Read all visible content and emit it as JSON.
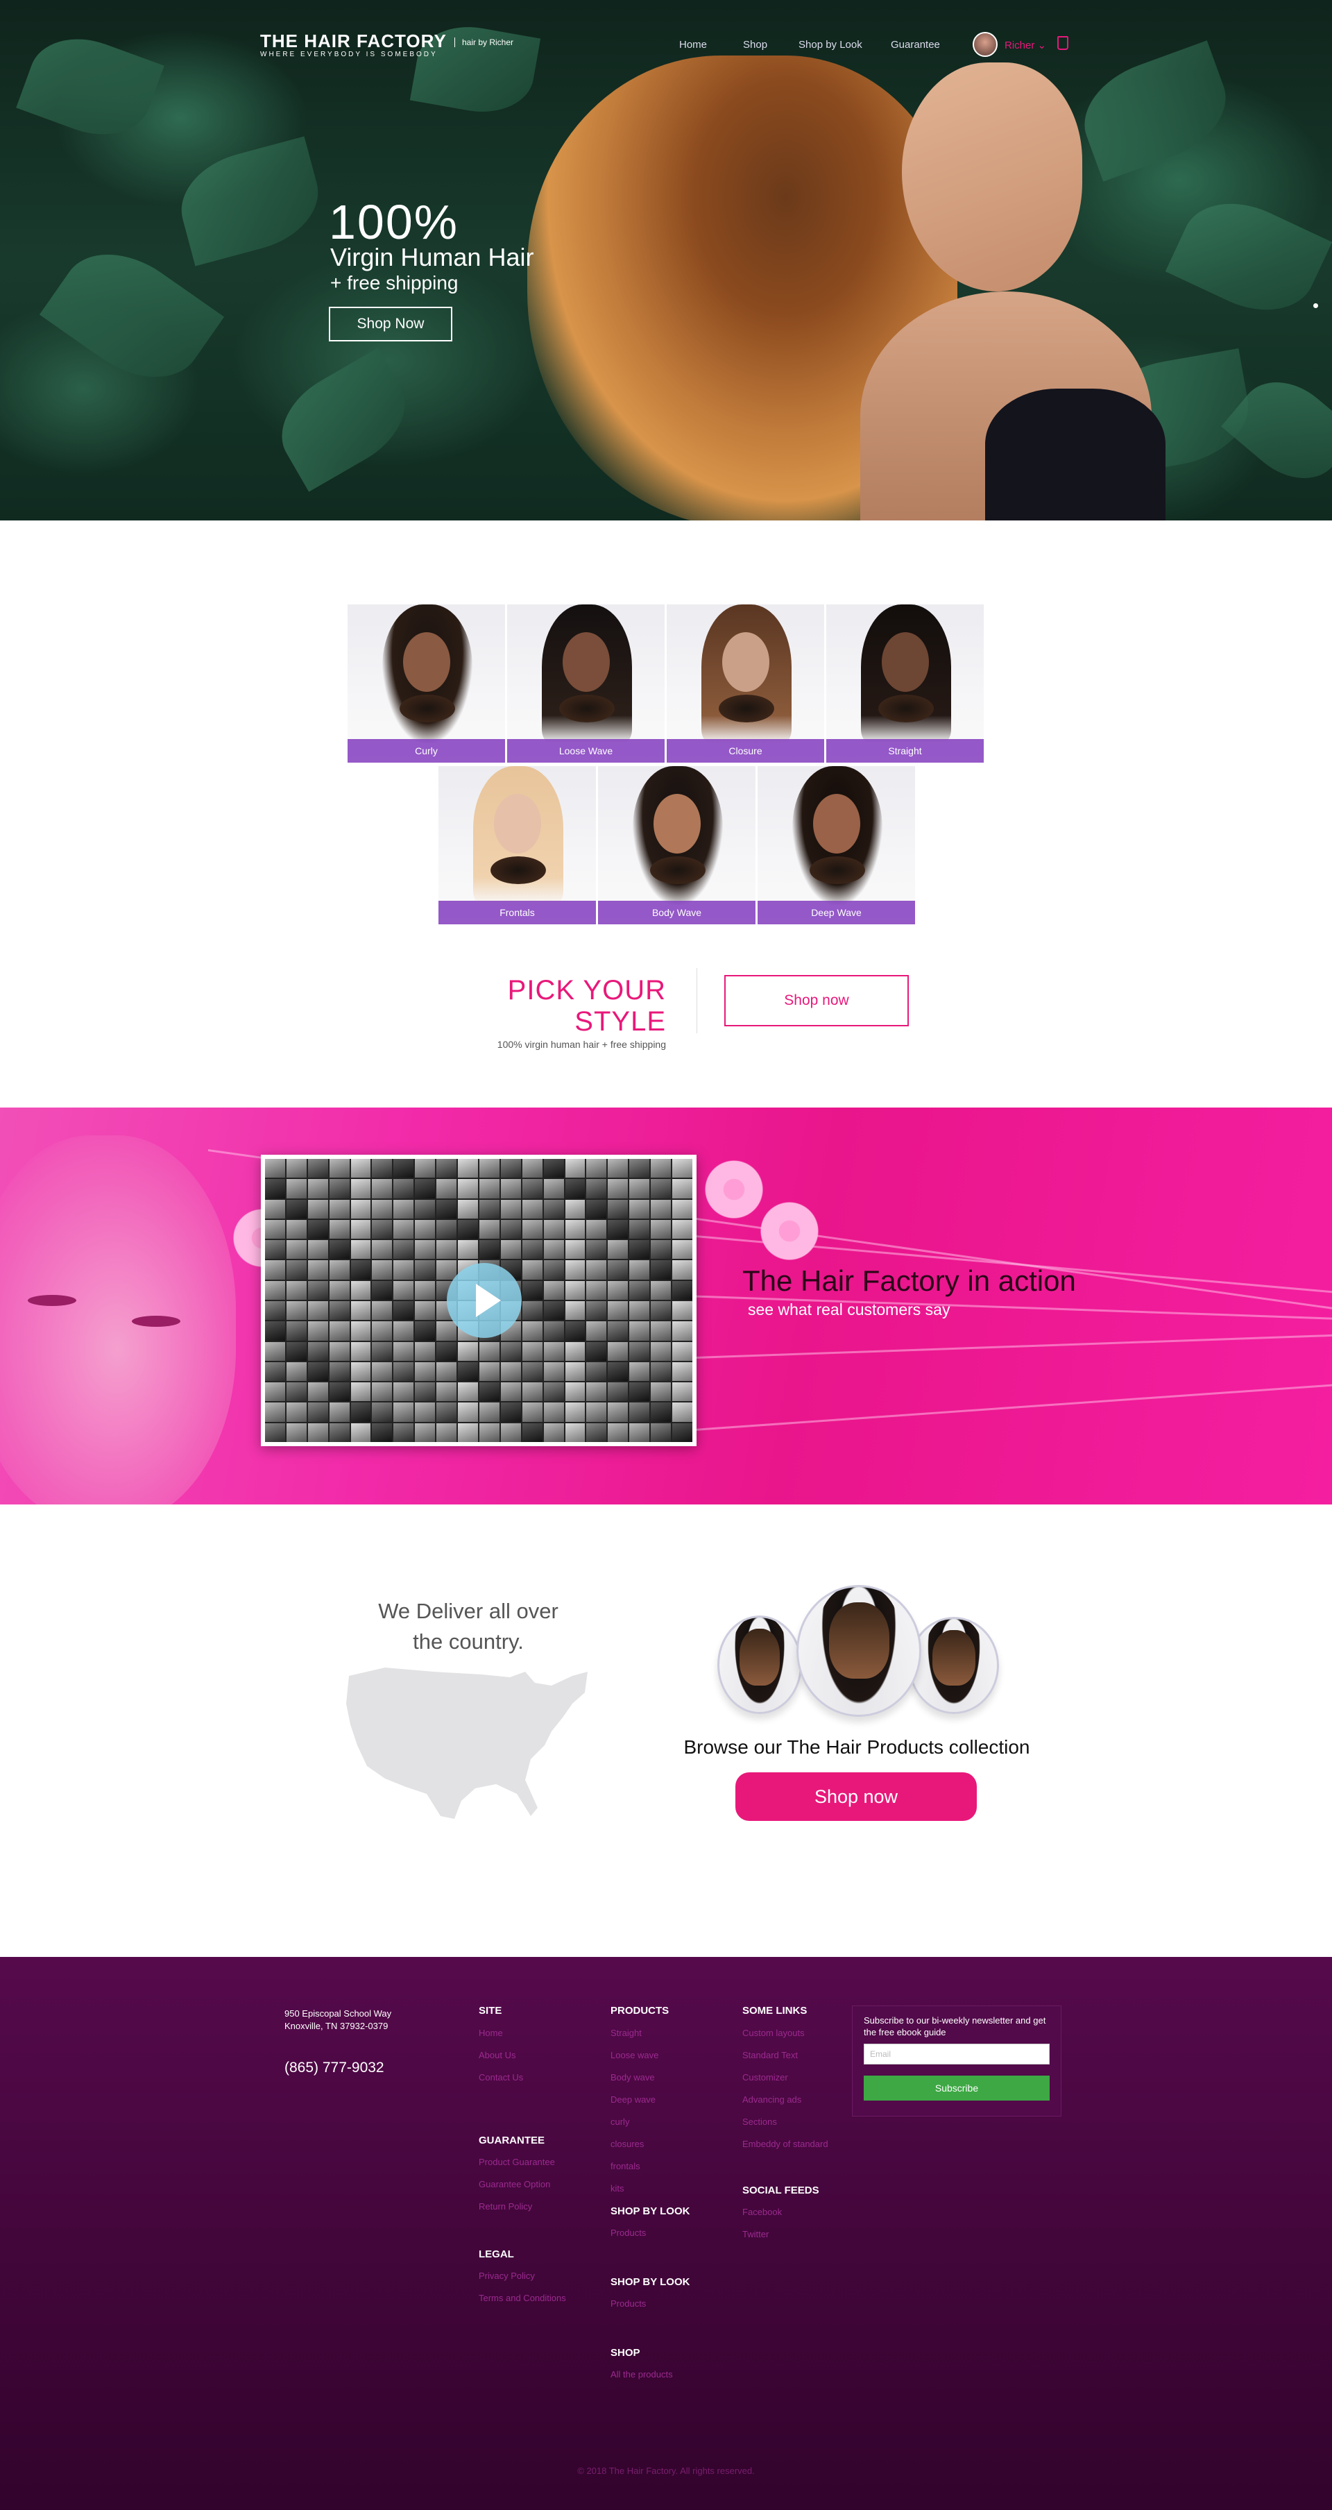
{
  "header": {
    "logo_title": "THE HAIR FACTORY",
    "logo_tagline": "WHERE EVERYBODY IS SOMEBODY",
    "logo_sub": "hair by Richer",
    "nav": [
      {
        "label": "Home"
      },
      {
        "label": "Shop"
      },
      {
        "label": "Shop by Look"
      },
      {
        "label": "Guarantee"
      }
    ],
    "user_name": "Richer"
  },
  "hero": {
    "headline": "100%",
    "line2": "Virgin Human Hair",
    "line3": "+ free shipping",
    "button": "Shop Now"
  },
  "styles": {
    "tiles": [
      {
        "label": "Curly"
      },
      {
        "label": "Loose Wave"
      },
      {
        "label": "Closure"
      },
      {
        "label": "Straight"
      },
      {
        "label": "Frontals"
      },
      {
        "label": "Body Wave"
      },
      {
        "label": "Deep Wave"
      }
    ],
    "title": "PICK YOUR STYLE",
    "subtitle": "100% virgin human hair + free shipping",
    "button": "Shop now"
  },
  "action": {
    "title": "The Hair Factory in action",
    "subtitle": "see what real customers say"
  },
  "deliver": {
    "title": "We Deliver all over the country.",
    "browse": "Browse our The Hair Products collection",
    "button": "Shop now"
  },
  "footer": {
    "address1": "950 Episcopal School Way",
    "address2": "Knoxville, TN 37932-0379",
    "phone": "(865) 777-9032",
    "site": {
      "title": "SITE",
      "links": [
        "Home",
        "About Us",
        "Contact Us"
      ]
    },
    "guarantee": {
      "title": "GUARANTEE",
      "links": [
        "Product Guarantee",
        "Guarantee Option",
        "Return Policy"
      ]
    },
    "legal": {
      "title": "LEGAL",
      "links": [
        "Privacy Policy",
        "Terms and Conditions"
      ]
    },
    "products": {
      "title": "PRODUCTS",
      "links": [
        "Straight",
        "Loose wave",
        "Body wave",
        "Deep wave",
        "curly",
        "closures",
        "frontals",
        "kits"
      ]
    },
    "shop_by_look1": {
      "title": "SHOP BY LOOK",
      "links": [
        "Products"
      ]
    },
    "shop_by_look2": {
      "title": "SHOP BY LOOK",
      "links": [
        "Products"
      ]
    },
    "shop": {
      "title": "SHOP",
      "links": [
        "All the products"
      ]
    },
    "some_links": {
      "title": "SOME LINKS",
      "links": [
        "Custom layouts",
        "Standard Text",
        "Customizer",
        "Advancing ads",
        "Sections",
        "Embeddy of standard"
      ]
    },
    "social": {
      "title": "SOCIAL FEEDS",
      "links": [
        "Facebook",
        "Twitter"
      ]
    },
    "newsletter": {
      "text": "Subscribe to our bi-weekly newsletter and get the free ebook guide",
      "placeholder": "Email",
      "button": "Subscribe"
    },
    "copyright": "© 2018 The Hair Factory. All rights reserved."
  },
  "colors": {
    "brand_pink": "#e8187a",
    "footer_purple": "#43063b",
    "subscribe_green": "#3da844",
    "tile_band_purple": "#823cbe"
  }
}
